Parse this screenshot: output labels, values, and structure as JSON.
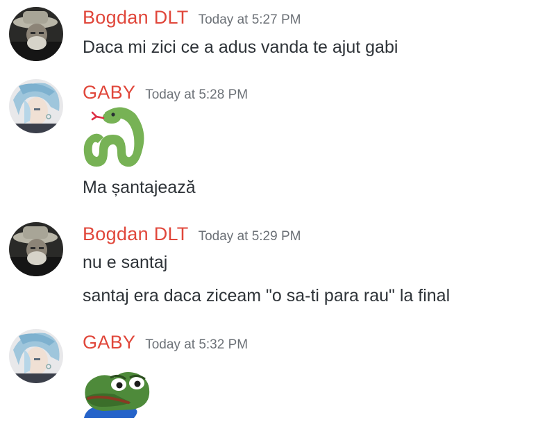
{
  "messages": [
    {
      "author": "Bogdan DLT",
      "timestamp": "Today at 5:27 PM",
      "avatar_icon": "bearded-man-hat-avatar",
      "lines": [
        "Daca mi zici ce a adus vanda te ajut gabi"
      ]
    },
    {
      "author": "GABY",
      "timestamp": "Today at 5:28 PM",
      "avatar_icon": "silver-hair-anime-avatar",
      "emoji": "snake-emoji",
      "lines": [
        "Ma șantajează"
      ]
    },
    {
      "author": "Bogdan DLT",
      "timestamp": "Today at 5:29 PM",
      "avatar_icon": "bearded-man-hat-avatar",
      "lines": [
        "nu e santaj",
        "santaj era daca ziceam \"o sa-ti para rau\" la final"
      ]
    },
    {
      "author": "GABY",
      "timestamp": "Today at 5:32 PM",
      "avatar_icon": "silver-hair-anime-avatar",
      "emoji": "sad-pepe-emoji"
    }
  ],
  "colors": {
    "username": "#e0473b",
    "timestamp": "#6c7177",
    "text": "#2e3338",
    "background": "#ffffff"
  }
}
